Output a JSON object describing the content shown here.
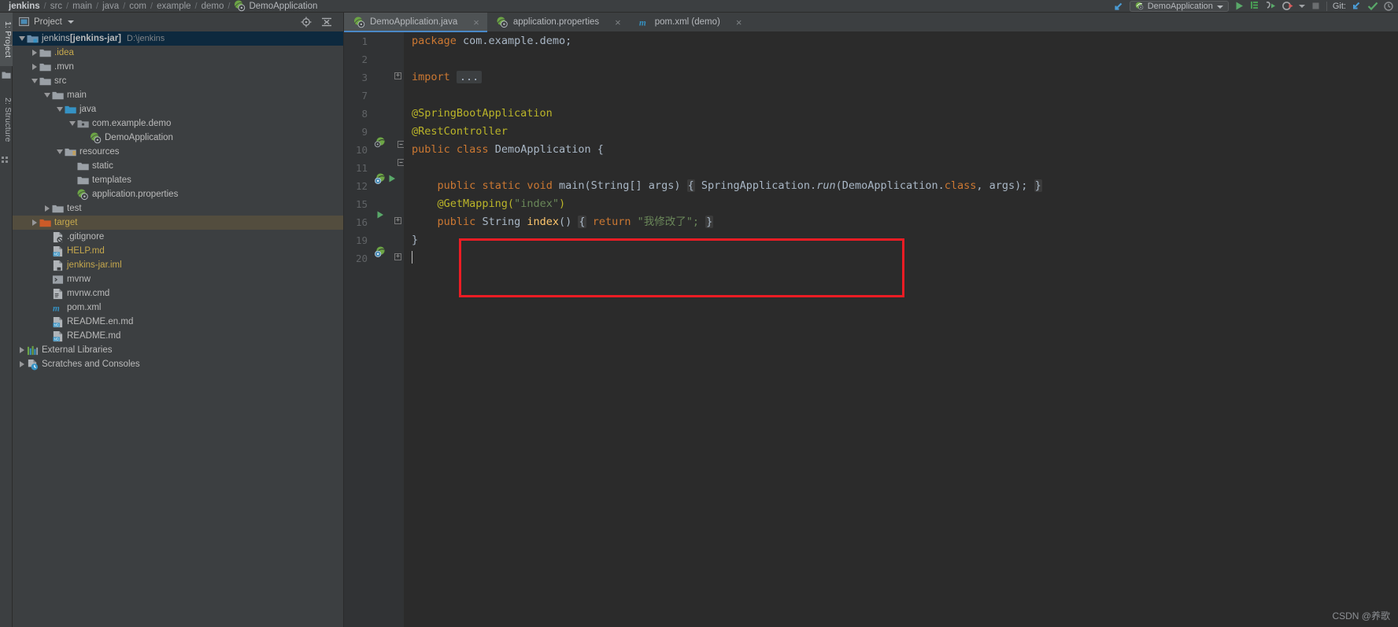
{
  "window": {
    "breadcrumbs": [
      {
        "label": "jenkins",
        "bold": true
      },
      {
        "label": "src",
        "bold": false
      },
      {
        "label": "main",
        "bold": false
      },
      {
        "label": "java",
        "bold": false
      },
      {
        "label": "com",
        "bold": false
      },
      {
        "label": "example",
        "bold": false
      },
      {
        "label": "demo",
        "bold": false
      }
    ],
    "breadcrumb_separator": "/",
    "breadcrumb_file": "DemoApplication",
    "run_configuration": "DemoApplication",
    "git_label": "Git:"
  },
  "left_strip": {
    "project_tab": "1: Project",
    "structure_tab": "2: Structure"
  },
  "project_panel": {
    "title": "Project",
    "tree": [
      {
        "label": "jenkins",
        "bold_part": "[jenkins-jar]",
        "sub": "D:\\jenkins",
        "indent": 0,
        "twisty": "open",
        "icon": "module-icon",
        "selected": "blue",
        "color": "normal"
      },
      {
        "label": ".idea",
        "indent": 1,
        "twisty": "closed",
        "icon": "folder-icon",
        "color": "yellowish"
      },
      {
        "label": ".mvn",
        "indent": 1,
        "twisty": "closed",
        "icon": "folder-icon",
        "color": "normal"
      },
      {
        "label": "src",
        "indent": 1,
        "twisty": "open",
        "icon": "folder-icon",
        "color": "normal"
      },
      {
        "label": "main",
        "indent": 2,
        "twisty": "open",
        "icon": "folder-icon",
        "color": "normal"
      },
      {
        "label": "java",
        "indent": 3,
        "twisty": "open",
        "icon": "source-folder-icon",
        "color": "normal"
      },
      {
        "label": "com.example.demo",
        "indent": 4,
        "twisty": "open",
        "icon": "package-icon",
        "color": "normal"
      },
      {
        "label": "DemoApplication",
        "indent": 5,
        "twisty": "none",
        "icon": "spring-class-icon",
        "color": "normal"
      },
      {
        "label": "resources",
        "indent": 3,
        "twisty": "open",
        "icon": "resource-folder-icon",
        "color": "normal"
      },
      {
        "label": "static",
        "indent": 4,
        "twisty": "none",
        "icon": "folder-icon",
        "color": "normal"
      },
      {
        "label": "templates",
        "indent": 4,
        "twisty": "none",
        "icon": "folder-icon",
        "color": "normal"
      },
      {
        "label": "application.properties",
        "indent": 4,
        "twisty": "none",
        "icon": "spring-properties-icon",
        "color": "normal"
      },
      {
        "label": "test",
        "indent": 2,
        "twisty": "closed",
        "icon": "folder-icon",
        "color": "normal"
      },
      {
        "label": "target",
        "indent": 1,
        "twisty": "closed",
        "icon": "excluded-folder-icon",
        "selected": "olive",
        "color": "yellowish"
      },
      {
        "label": ".gitignore",
        "indent": 2,
        "twisty": "none",
        "icon": "gitignore-icon",
        "color": "normal"
      },
      {
        "label": "HELP.md",
        "indent": 2,
        "twisty": "none",
        "icon": "markdown-icon",
        "color": "yellowish"
      },
      {
        "label": "jenkins-jar.iml",
        "indent": 2,
        "twisty": "none",
        "icon": "iml-icon",
        "color": "yellowish"
      },
      {
        "label": "mvnw",
        "indent": 2,
        "twisty": "none",
        "icon": "shell-icon",
        "color": "normal"
      },
      {
        "label": "mvnw.cmd",
        "indent": 2,
        "twisty": "none",
        "icon": "cmd-icon",
        "color": "normal"
      },
      {
        "label": "pom.xml",
        "indent": 2,
        "twisty": "none",
        "icon": "maven-icon",
        "color": "normal"
      },
      {
        "label": "README.en.md",
        "indent": 2,
        "twisty": "none",
        "icon": "markdown-icon",
        "color": "normal"
      },
      {
        "label": "README.md",
        "indent": 2,
        "twisty": "none",
        "icon": "markdown-icon",
        "color": "normal"
      },
      {
        "label": "External Libraries",
        "indent": 0,
        "twisty": "closed",
        "icon": "libraries-icon",
        "color": "normal"
      },
      {
        "label": "Scratches and Consoles",
        "indent": 0,
        "twisty": "closed",
        "icon": "scratches-icon",
        "color": "normal"
      }
    ]
  },
  "editor": {
    "tabs": [
      {
        "label": "DemoApplication.java",
        "icon": "spring-class-icon",
        "active": true,
        "closable": true
      },
      {
        "label": "application.properties",
        "icon": "spring-properties-icon",
        "active": false,
        "closable": true
      },
      {
        "label": "pom.xml (demo)",
        "icon": "maven-icon",
        "active": false,
        "closable": true
      }
    ],
    "line_numbers": [
      "1",
      "2",
      "3",
      "7",
      "8",
      "9",
      "10",
      "11",
      "12",
      "15",
      "16",
      "19",
      "20"
    ],
    "lines": [
      {
        "n": "1",
        "text": "package com.example.demo;"
      },
      {
        "n": "2",
        "text": ""
      },
      {
        "n": "3",
        "text": "import ..."
      },
      {
        "n": "7",
        "text": ""
      },
      {
        "n": "8",
        "text": "@SpringBootApplication"
      },
      {
        "n": "9",
        "text": "@RestController"
      },
      {
        "n": "10",
        "text": "public class DemoApplication {"
      },
      {
        "n": "11",
        "text": ""
      },
      {
        "n": "12",
        "text": "    public static void main(String[] args) { SpringApplication.run(DemoApplication.class, args); }"
      },
      {
        "n": "15",
        "text": "    @GetMapping(\"index\")"
      },
      {
        "n": "16",
        "text": "    public String index() { return \"我修改了\"; }"
      },
      {
        "n": "19",
        "text": "}"
      },
      {
        "n": "20",
        "text": ""
      }
    ],
    "tokens": {
      "package_kw": "package",
      "package_name": "com.example.demo;",
      "import_kw": "import",
      "import_fold": "...",
      "ann_springboot": "@SpringBootApplication",
      "ann_restcontroller": "@RestController",
      "kw_public": "public",
      "kw_class": "class",
      "kw_static": "static",
      "kw_void": "void",
      "kw_return": "return",
      "type_demoapplication": "DemoApplication",
      "brace_open": "{",
      "brace_close": "}",
      "main_name": "main",
      "main_params": "(String[] args)",
      "springapplication": "SpringApplication",
      "dot": ".",
      "run_method": "run",
      "run_args": "(DemoApplication.",
      "kw_class2": "class",
      "run_args_tail": ", args);",
      "ann_getmapping": "@GetMapping",
      "getmapping_paren_open": "(",
      "getmapping_value": "\"index\"",
      "getmapping_paren_close": ")",
      "type_string": "String",
      "index_name": "index",
      "index_parens": "()",
      "return_value": "\"我修改了\";"
    }
  },
  "annotation": {
    "highlight_color": "#ec1c24"
  },
  "watermark": "CSDN @养歌",
  "colors": {
    "panel_bg": "#3c3f41",
    "editor_bg": "#2b2b2b",
    "gutter_bg": "#313335",
    "selection_blue": "#0d293e",
    "selection_olive": "#534d3e",
    "tab_active": "#4e5254",
    "tab_underline": "#4a88c7",
    "keyword": "#cc7832",
    "string": "#6a8759",
    "annotation": "#bbb529",
    "plain": "#a9b7c6",
    "linenum": "#606366"
  }
}
